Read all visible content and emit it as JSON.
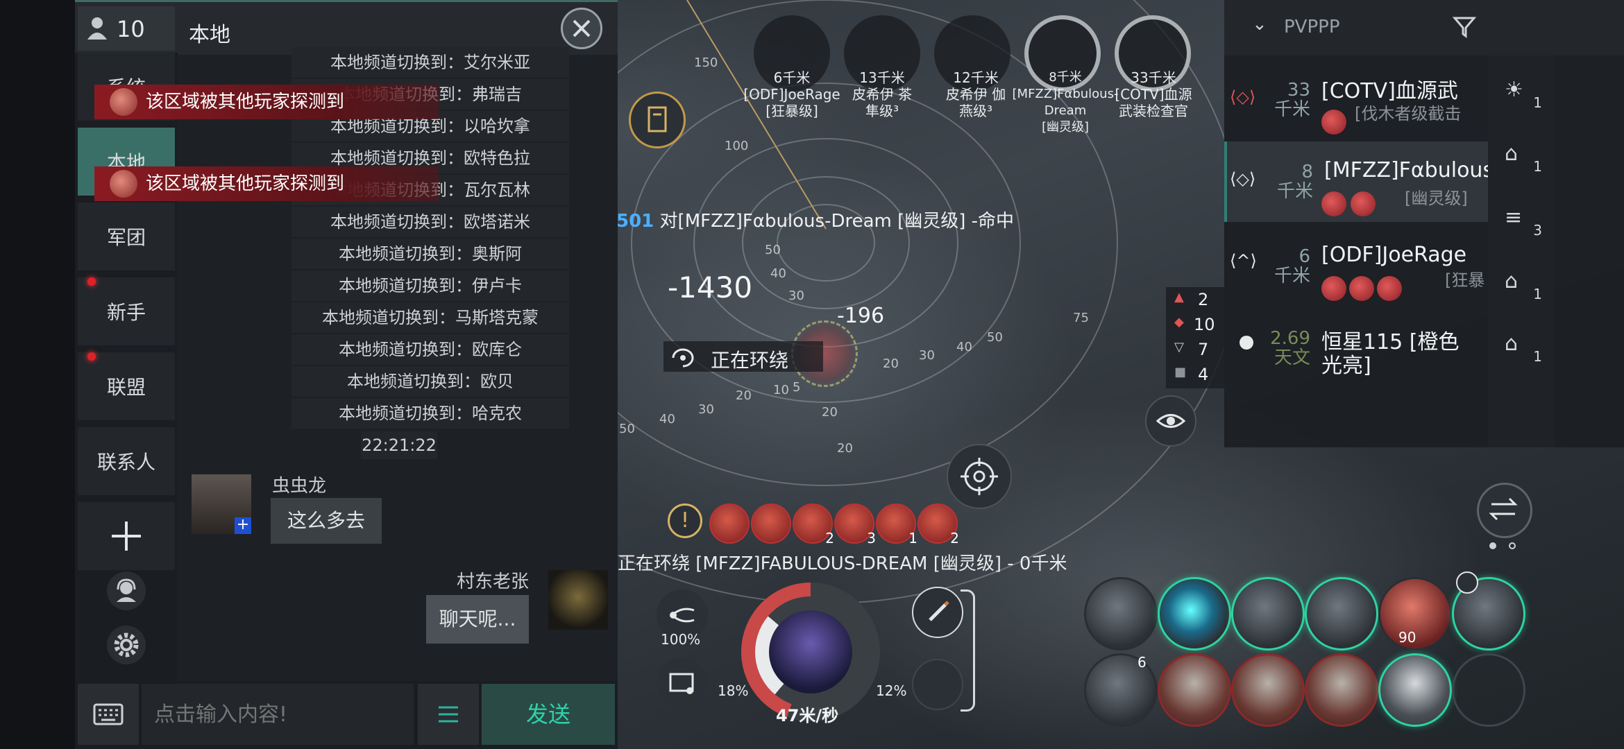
{
  "chat": {
    "member_count": "10",
    "channel_title": "本地",
    "tabs": [
      "系统",
      "本地",
      "军团",
      "新手",
      "联盟",
      "联系人"
    ],
    "messages": [
      "本地频道切换到：艾尔米亚",
      "本地频道切换到：弗瑞吉",
      "本地频道切换到：以哈坎拿",
      "本地频道切换到：欧特色拉",
      "本地频道切换到：瓦尔瓦林",
      "本地频道切换到：欧塔诺米",
      "本地频道切换到：奥斯阿",
      "本地频道切换到：伊卢卡",
      "本地频道切换到：马斯塔克蒙",
      "本地频道切换到：欧库仑",
      "本地频道切换到：欧贝",
      "本地频道切换到：哈克农"
    ],
    "timestamp": "22:21:22",
    "user1": {
      "name": "虫虫龙",
      "text": "这么多去"
    },
    "user2": {
      "name": "村东老张",
      "text": "聊天呢..."
    },
    "detect_alert": "该区域被其他玩家探测到",
    "input_placeholder": "点击输入内容!",
    "send_label": "发送"
  },
  "targets": [
    {
      "dist": "6千米",
      "name": "[ODF]JoeRage",
      "class": "[狂暴级]"
    },
    {
      "dist": "13千米",
      "name": "皮希伊 茶",
      "class": "隼级³"
    },
    {
      "dist": "12千米",
      "name": "皮希伊 伽",
      "class": "燕级³"
    },
    {
      "dist": "8千米",
      "name": "[MFZZ]Fαbulous-Dream",
      "class": "[幽灵级]"
    },
    {
      "dist": "33千米",
      "name": "[COTV]血源",
      "class": "武装检查官"
    }
  ],
  "combat": {
    "hit_prefix": "501",
    "hit_text": "对[MFZZ]Fαbulous-Dream [幽灵级] -命中",
    "dmg1": "-1430",
    "dmg2": "-196",
    "orbit_label": "正在环绕",
    "orbit_status": "正在环绕 [MFZZ]FABULOUS-DREAM [幽灵级] - 0千米",
    "ring_labels": [
      "150",
      "100",
      "50",
      "40",
      "30",
      "20",
      "10",
      "5",
      "75",
      "50",
      "40",
      "30",
      "20",
      "10",
      "5",
      "50",
      "40",
      "30",
      "20",
      "10",
      "5",
      "20",
      "10"
    ]
  },
  "filters": [
    {
      "icon": "triangle",
      "count": "2"
    },
    {
      "icon": "diamond",
      "count": "10"
    },
    {
      "icon": "shield",
      "count": "7"
    },
    {
      "icon": "square",
      "count": "4"
    }
  ],
  "overview": {
    "preset": "PVPPP",
    "rows": [
      {
        "dist": "33",
        "unit": "千米",
        "name": "[COTV]血源武",
        "sub": "[伐木者级截击"
      },
      {
        "dist": "8",
        "unit": "千米",
        "name": "[MFZZ]Fαbulous-",
        "sub": "[幽灵级]"
      },
      {
        "dist": "6",
        "unit": "千米",
        "name": "[ODF]JoeRage",
        "sub": "[狂暴"
      },
      {
        "dist": "2.69",
        "unit": "天文",
        "name": "恒星115 [橙色",
        "sub": "光亮]"
      }
    ],
    "side_counts": [
      "1",
      "1",
      "3",
      "1",
      "1"
    ]
  },
  "ship": {
    "speed": "47米/秒",
    "left_pct": "100%",
    "cap_pct": "18%",
    "right_pct": "12%"
  },
  "module_counts": {
    "row1_last": "90",
    "row2_first": "6"
  },
  "effect_counts": [
    "2",
    "3",
    "1",
    "2"
  ]
}
